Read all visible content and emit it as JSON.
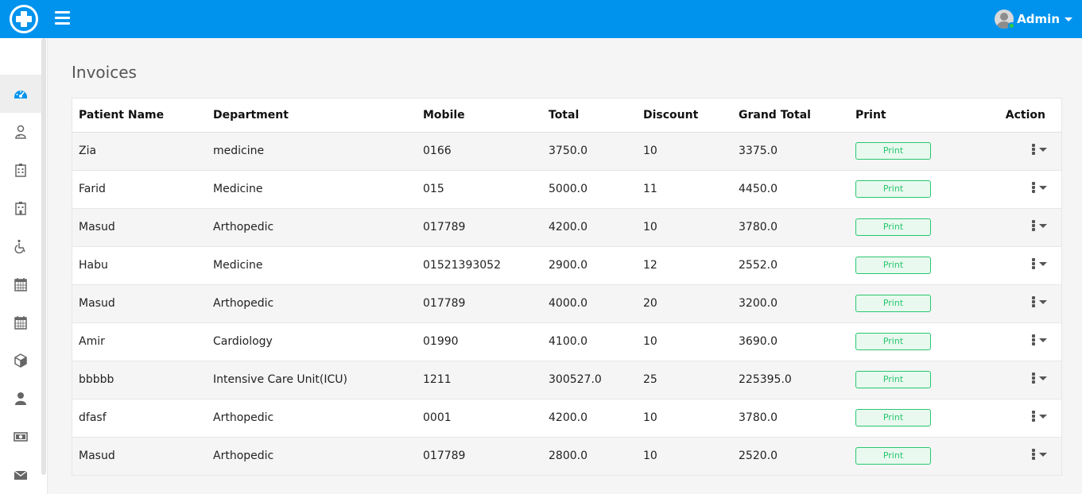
{
  "header": {
    "logo_icon": "medical-cross-icon",
    "menu_icon": "hamburger-menu-icon",
    "user_name": "Admin",
    "brand_color": "#0093ee",
    "online_color": "#2ecc40"
  },
  "sidebar": {
    "items": [
      {
        "icon": "dashboard-icon",
        "active": true
      },
      {
        "icon": "doctor-icon"
      },
      {
        "icon": "hospital-icon"
      },
      {
        "icon": "hospital-building-icon"
      },
      {
        "icon": "wheelchair-icon"
      },
      {
        "icon": "calendar-icon"
      },
      {
        "icon": "calendar-alt-icon"
      },
      {
        "icon": "box-icon"
      },
      {
        "icon": "user-icon"
      },
      {
        "icon": "money-icon"
      },
      {
        "icon": "envelope-icon"
      }
    ]
  },
  "page": {
    "title": "Invoices"
  },
  "table": {
    "columns": {
      "patient_name": "Patient Name",
      "department": "Department",
      "mobile": "Mobile",
      "total": "Total",
      "discount": "Discount",
      "grand_total": "Grand Total",
      "print": "Print",
      "action": "Action"
    },
    "print_label": "Print",
    "print_color": "#28c76f",
    "rows": [
      {
        "patient_name": "Zia",
        "department": "medicine",
        "mobile": "0166",
        "total": "3750.0",
        "discount": "10",
        "grand_total": "3375.0"
      },
      {
        "patient_name": "Farid",
        "department": "Medicine",
        "mobile": "015",
        "total": "5000.0",
        "discount": "11",
        "grand_total": "4450.0"
      },
      {
        "patient_name": "Masud",
        "department": "Arthopedic",
        "mobile": "017789",
        "total": "4200.0",
        "discount": "10",
        "grand_total": "3780.0"
      },
      {
        "patient_name": "Habu",
        "department": "Medicine",
        "mobile": "01521393052",
        "total": "2900.0",
        "discount": "12",
        "grand_total": "2552.0"
      },
      {
        "patient_name": "Masud",
        "department": "Arthopedic",
        "mobile": "017789",
        "total": "4000.0",
        "discount": "20",
        "grand_total": "3200.0"
      },
      {
        "patient_name": "Amir",
        "department": "Cardiology",
        "mobile": "01990",
        "total": "4100.0",
        "discount": "10",
        "grand_total": "3690.0"
      },
      {
        "patient_name": "bbbbb",
        "department": "Intensive Care Unit(ICU)",
        "mobile": "1211",
        "total": "300527.0",
        "discount": "25",
        "grand_total": "225395.0"
      },
      {
        "patient_name": "dfasf",
        "department": "Arthopedic",
        "mobile": "0001",
        "total": "4200.0",
        "discount": "10",
        "grand_total": "3780.0"
      },
      {
        "patient_name": "Masud",
        "department": "Arthopedic",
        "mobile": "017789",
        "total": "2800.0",
        "discount": "10",
        "grand_total": "2520.0"
      }
    ]
  }
}
